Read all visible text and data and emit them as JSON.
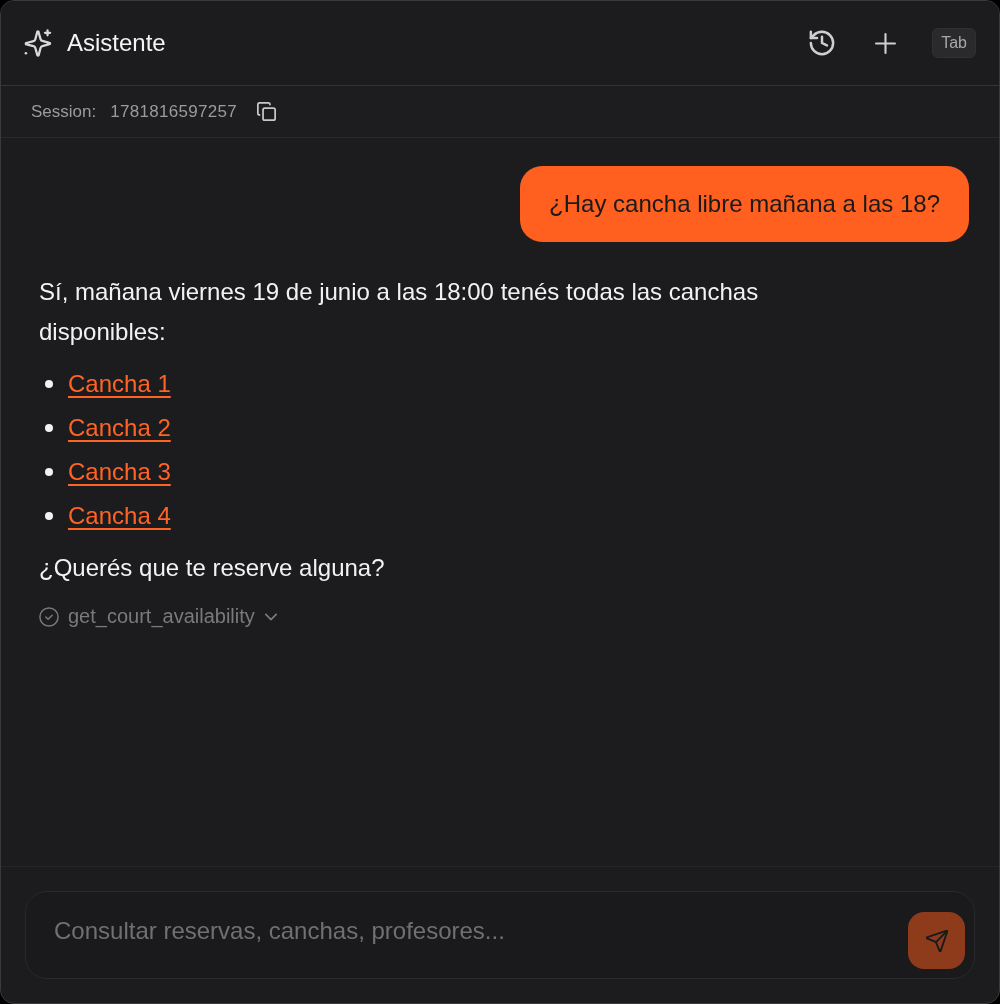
{
  "header": {
    "title": "Asistente",
    "shortcut_hint": "Tab"
  },
  "session": {
    "label": "Session:",
    "id": "1781816597257"
  },
  "messages": [
    {
      "kind": "user",
      "text": "¿Hay cancha libre mañana a las 18?"
    },
    {
      "kind": "assistant",
      "blocks": [
        {
          "kind": "paragraph",
          "text": "Sí, mañana viernes 19 de junio a las 18:00 tenés todas las canchas disponibles:"
        },
        {
          "kind": "list",
          "items": [
            "Cancha 1",
            "Cancha 2",
            "Cancha 3",
            "Cancha 4"
          ]
        },
        {
          "kind": "paragraph",
          "text": "¿Querés que te reserve alguna?"
        }
      ],
      "tool_call": {
        "name": "get_court_availability",
        "expanded": false
      }
    }
  ],
  "composer": {
    "placeholder": "Consultar reservas, canchas, profesores...",
    "send_disabled": true
  }
}
